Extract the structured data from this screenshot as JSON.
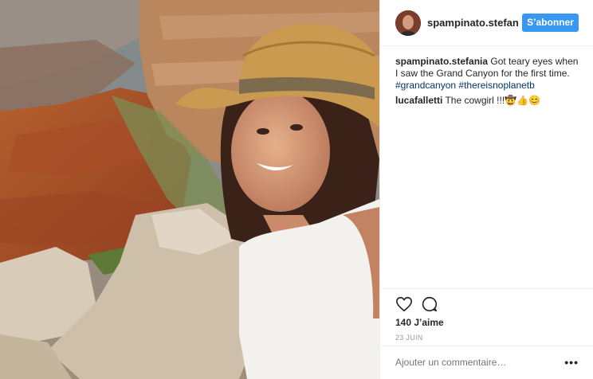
{
  "post": {
    "username": "spampinato.stefan",
    "follow_label": "S’abonner"
  },
  "comments": [
    {
      "author": "spampinato.stefania",
      "text": " Got teary eyes when I saw the Grand Canyon for the first time. ",
      "tags": [
        "#grandcanyon",
        "#thereisnoplanetb"
      ]
    },
    {
      "author": "lucafalletti",
      "text": " The cowgirl !!!🤠👍😊",
      "tags": []
    }
  ],
  "stats": {
    "likes": "140 J’aime",
    "date": "23 JUIN"
  },
  "composer": {
    "placeholder": "Ajouter un commentaire…",
    "more_label": "•••"
  },
  "icons": {
    "like": "heart-icon",
    "comment": "comment-bubble-icon",
    "more": "more-dots-icon"
  }
}
